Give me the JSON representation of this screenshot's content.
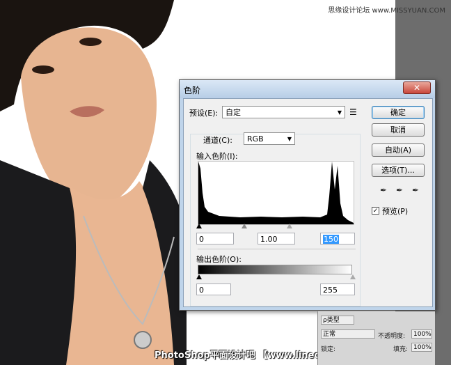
{
  "watermarks": {
    "top": "思缘设计论坛 www.MISSYUAN.COM",
    "bottom": "PhotoShop平面设计吧 【www.linecg.com/tieba/1783】"
  },
  "dialog": {
    "title": "色阶",
    "close_label": "✕",
    "preset_label": "预设(E):",
    "preset_value": "自定",
    "preset_menu_icon": "list-icon",
    "channel_label": "通道(C):",
    "channel_value": "RGB",
    "input_levels_label": "输入色阶(I):",
    "input_black": "0",
    "input_gamma": "1.00",
    "input_white": "150",
    "output_levels_label": "输出色阶(O):",
    "output_black": "0",
    "output_white": "255",
    "buttons": {
      "ok": "确定",
      "cancel": "取消",
      "auto": "自动(A)",
      "options": "选项(T)..."
    },
    "preview_label": "预览(P)",
    "preview_checked": true,
    "eyedroppers": [
      "black-eyedropper-icon",
      "gray-eyedropper-icon",
      "white-eyedropper-icon"
    ]
  },
  "layers_panel": {
    "kind_label": "ρ类型",
    "blend_mode": "正常",
    "opacity_label": "不透明度:",
    "opacity_value": "100%",
    "lock_label": "锁定:",
    "fill_label": "填充:",
    "fill_value": "100%"
  }
}
